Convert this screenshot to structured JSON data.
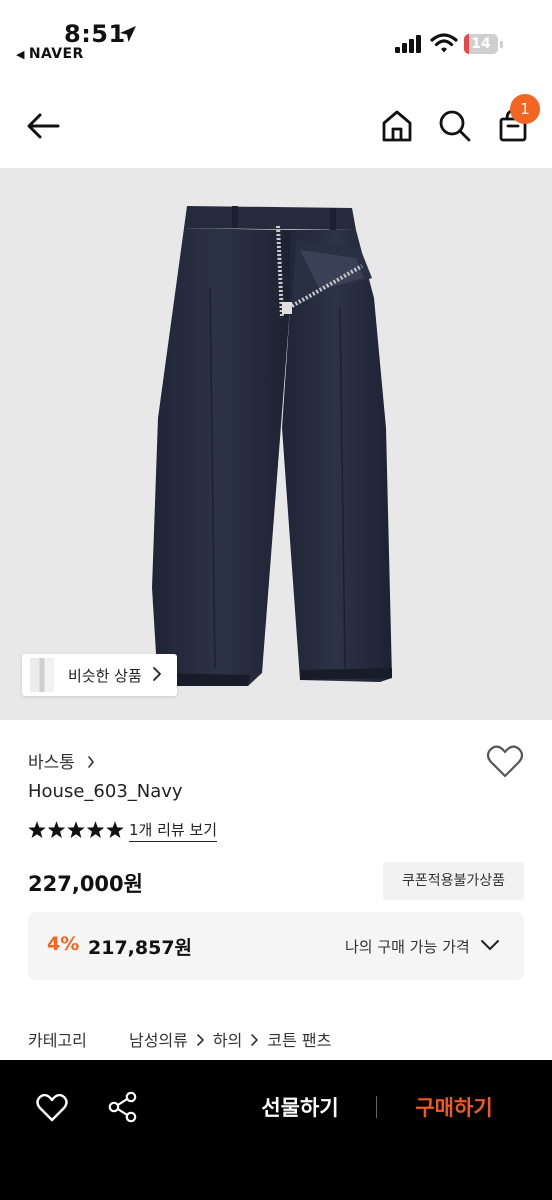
{
  "status_bar": {
    "time": "8:51",
    "back_app": "NAVER",
    "battery_level": "14",
    "battery_color": "#e8474c"
  },
  "nav": {
    "icons": [
      "back-arrow-icon",
      "home-icon",
      "search-icon",
      "shopping-bag-icon"
    ],
    "cart_count": "1",
    "accent": "#f26522"
  },
  "product": {
    "image": "navy-chino-pants",
    "similar_label": "비슷한 상품",
    "brand": "바스통",
    "name": "House_603_Navy",
    "rating_stars": 5,
    "review_link": "1개 리뷰 보기",
    "price": "227,000원",
    "coupon_tag": "쿠폰적용불가상품",
    "discount_rate": "4%",
    "my_price": "217,857원",
    "my_price_label": "나의 구매 가능 가격"
  },
  "category": {
    "label": "카테고리",
    "path": [
      "남성의류",
      "하의",
      "코튼 팬츠"
    ]
  },
  "bottom_bar": {
    "gift_label": "선물하기",
    "buy_label": "구매하기",
    "buy_color": "#f25a1d"
  }
}
